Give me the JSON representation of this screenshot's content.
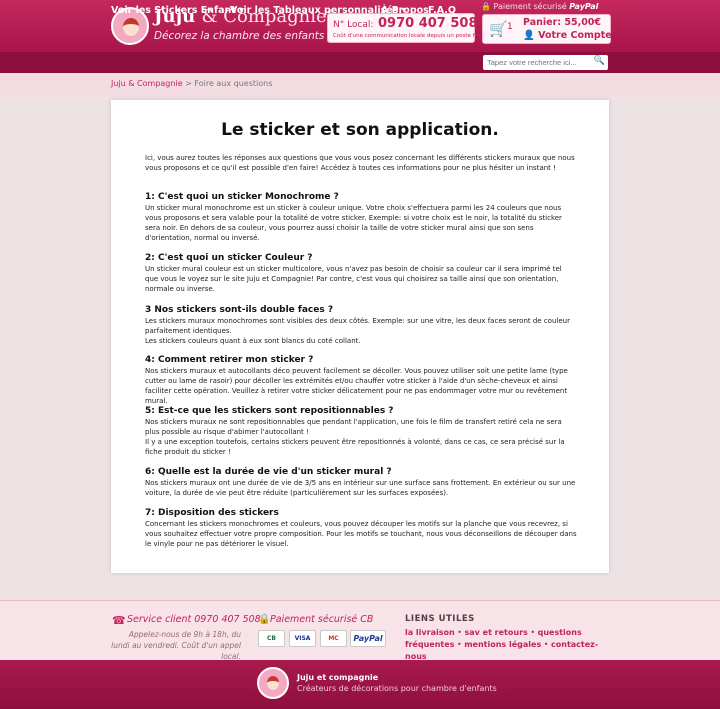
{
  "header": {
    "brand_main": "Juju",
    "brand_amp": "& Compagnie",
    "brand_reg": "®",
    "tagline": "Décorez la chambre des enfants",
    "phone_label": "N° Local:",
    "phone_number": "0970 407 508",
    "phone_note": "Coût d'une communication locale depuis un poste fixe",
    "secure_label": "Paiement sécurisé",
    "secure_brand": "PayPal",
    "cart_count": "1",
    "cart_total": "Panier: 55,00€",
    "account_label": "Votre Compte"
  },
  "nav": {
    "items": [
      {
        "label": "Voir les Stickers Enfant ▾"
      },
      {
        "label": "Voir les Tableaux personnalisés ▾"
      },
      {
        "label": "À Propos"
      },
      {
        "label": "F.A.Q"
      }
    ],
    "search_placeholder": "Tapez votre recherche ici..."
  },
  "breadcrumb": {
    "home": "Juju & Compagnie",
    "separator": " > ",
    "current": "Foire aux questions"
  },
  "content": {
    "title": "Le sticker et son application.",
    "intro": "Ici, vous aurez toutes les réponses aux questions que vous vous posez concernant les différents stickers muraux que nous vous proposons et ce qu'il est possible d'en faire! Accédez à toutes ces informations pour ne plus hésiter un instant !",
    "faqs": [
      {
        "question": "1: C'est quoi un sticker Monochrome ?",
        "answer": "Un sticker mural monochrome est un sticker à couleur unique. Votre choix s'effectuera parmi les 24 couleurs que nous vous proposons et sera valable pour la totalité de votre sticker. Exemple: si votre choix est le noir, la totalité du sticker sera noir. En dehors de sa couleur, vous pourrez aussi choisir la taille de votre sticker mural ainsi que son sens d'orientation, normal ou inversé."
      },
      {
        "question": "2: C'est quoi un sticker Couleur ?",
        "answer": "Un sticker mural couleur est un sticker multicolore, vous n'avez pas besoin de choisir sa couleur car il sera imprimé tel que vous le voyez sur le site Juju et Compagnie! Par contre, c'est vous qui choisirez sa taille ainsi que son orientation, normale ou inverse."
      },
      {
        "question": "3 Nos stickers sont-ils double faces ?",
        "answer": "Les stickers muraux monochromes sont visibles des deux côtés. Exemple: sur une vitre, les deux faces seront de couleur parfaitement identiques.\nLes stickers couleurs quant à eux sont blancs du coté collant."
      },
      {
        "question": "4: Comment retirer mon sticker ?",
        "answer": "Nos stickers muraux et autocollants déco peuvent facilement se décoller. Vous pouvez utiliser soit une petite lame (type cutter ou lame de rasoir) pour décoller les extrémités et/ou chauffer votre sticker à l'aide d'un sèche-cheveux et ainsi faciliter cette opération. Veuillez à retirer votre sticker délicatement pour ne pas endommager votre mur ou revêtement mural."
      },
      {
        "question": "5: Est-ce que les stickers sont repositionnables ?",
        "answer": "Nos stickers muraux ne sont repositionnables que pendant l'application, une fois le film de transfert retiré cela ne sera plus possible au risque d'abimer l'autocollant !\nIl y a une exception toutefois, certains stickers peuvent être repositionnés à volonté, dans ce cas, ce sera précisé sur la fiche produit du sticker !"
      },
      {
        "question": "6: Quelle est la durée de vie d'un sticker mural ?",
        "answer": "Nos stickers muraux ont une durée de vie de 3/5 ans en intérieur sur une surface sans frottement. En extérieur ou sur une voiture, la durée de vie peut être réduite (particulièrement sur les surfaces exposées)."
      },
      {
        "question": "7: Disposition des stickers",
        "answer": "Concernant les stickers monochromes et couleurs, vous pouvez découper les motifs sur la planche que vous recevrez, si vous souhaitez effectuer votre propre composition. Pour les motifs se touchant, nous vous déconseillons de découper dans le vinyle pour ne pas détériorer le visuel."
      }
    ]
  },
  "footer": {
    "service_title": "Service client 0970 407 508",
    "service_note": "Appelez-nous de 9h à 18h, du lundi au vendredi. Coût d'un appel local.",
    "payment_title": "Paiement sécurisé CB",
    "payment_logos": [
      "CB",
      "VISA",
      "MC"
    ],
    "paypal_logo": "PayPal",
    "links_title": "LIENS UTILES",
    "links": [
      "la livraison",
      "sav et retours",
      "questions fréquentes",
      "mentions légales",
      "contactez-nous"
    ],
    "link_separator": " • ",
    "brand_name": "Juju et compagnie",
    "brand_tagline": "Créateurs de décorations pour chambre d'enfants"
  },
  "colors": {
    "brand": "#c0245a",
    "nav": "#8e0f3d",
    "background": "#ece2e4"
  }
}
